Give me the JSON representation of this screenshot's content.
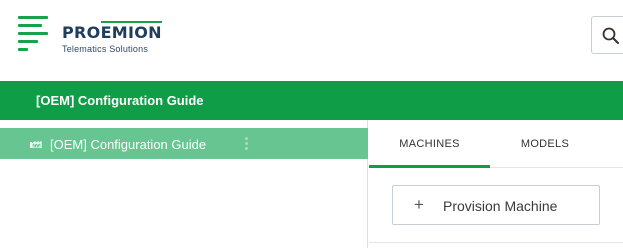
{
  "brand": {
    "name_part1": "PRO",
    "name_part2": "EMION",
    "tagline": "Telematics Solutions",
    "accent_color": "#0f9d48"
  },
  "header": {
    "search_icon": "search-icon"
  },
  "title_bar": {
    "title": "[OEM] Configuration Guide"
  },
  "sidebar": {
    "items": [
      {
        "icon": "factory-icon",
        "label": "[OEM] Configuration Guide",
        "menu_icon": "more-vertical-icon",
        "selected": true
      }
    ]
  },
  "main": {
    "tabs": [
      {
        "label": "MACHINES",
        "active": true
      },
      {
        "label": "MODELS",
        "active": false
      }
    ],
    "provision_button": {
      "icon": "plus-icon",
      "label": "Provision Machine"
    }
  }
}
